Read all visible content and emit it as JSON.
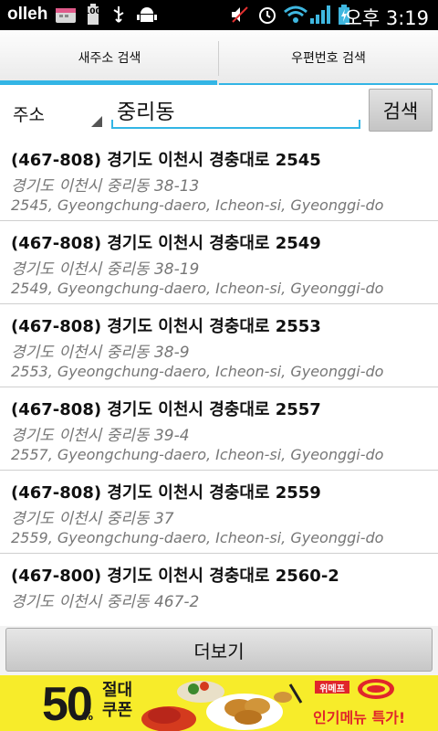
{
  "status_bar": {
    "carrier": "olleh",
    "battery_level": "100",
    "time": "오후 3:19"
  },
  "tabs": [
    {
      "label": "새주소 검색",
      "selected": true
    },
    {
      "label": "우편번호 검색",
      "selected": false
    }
  ],
  "search": {
    "type_selected": "주소",
    "query": "중리동",
    "button_label": "검색"
  },
  "results": [
    {
      "title": "(467-808) 경기도 이천시 경충대로 2545",
      "old_address": "경기도 이천시 중리동   38-13",
      "english": "2545, Gyeongchung-daero, Icheon-si, Gyeonggi-do"
    },
    {
      "title": "(467-808) 경기도 이천시 경충대로 2549",
      "old_address": "경기도 이천시 중리동   38-19",
      "english": "2549, Gyeongchung-daero, Icheon-si, Gyeonggi-do"
    },
    {
      "title": "(467-808) 경기도 이천시 경충대로 2553",
      "old_address": "경기도 이천시 중리동   38-9",
      "english": "2553, Gyeongchung-daero, Icheon-si, Gyeonggi-do"
    },
    {
      "title": "(467-808) 경기도 이천시 경충대로 2557",
      "old_address": "경기도 이천시 중리동   39-4",
      "english": "2557, Gyeongchung-daero, Icheon-si, Gyeonggi-do"
    },
    {
      "title": "(467-808) 경기도 이천시 경충대로 2559",
      "old_address": "경기도 이천시 중리동   37",
      "english": "2559, Gyeongchung-daero, Icheon-si, Gyeonggi-do"
    },
    {
      "title": "(467-800) 경기도 이천시 경충대로 2560-2",
      "old_address": "경기도 이천시 중리동   467-2",
      "english": ""
    }
  ],
  "more_button": {
    "label": "더보기"
  },
  "ad": {
    "big_number": "50",
    "percent": "%",
    "coupon_text": "절대 쿠폰",
    "brand_badge": "위메프",
    "menu_text": "인기메뉴 특가!",
    "colors": {
      "background": "#f7ec2a",
      "accent": "#e0262b"
    }
  },
  "colors": {
    "accent": "#33b5e5",
    "status_bar": "#000000"
  }
}
